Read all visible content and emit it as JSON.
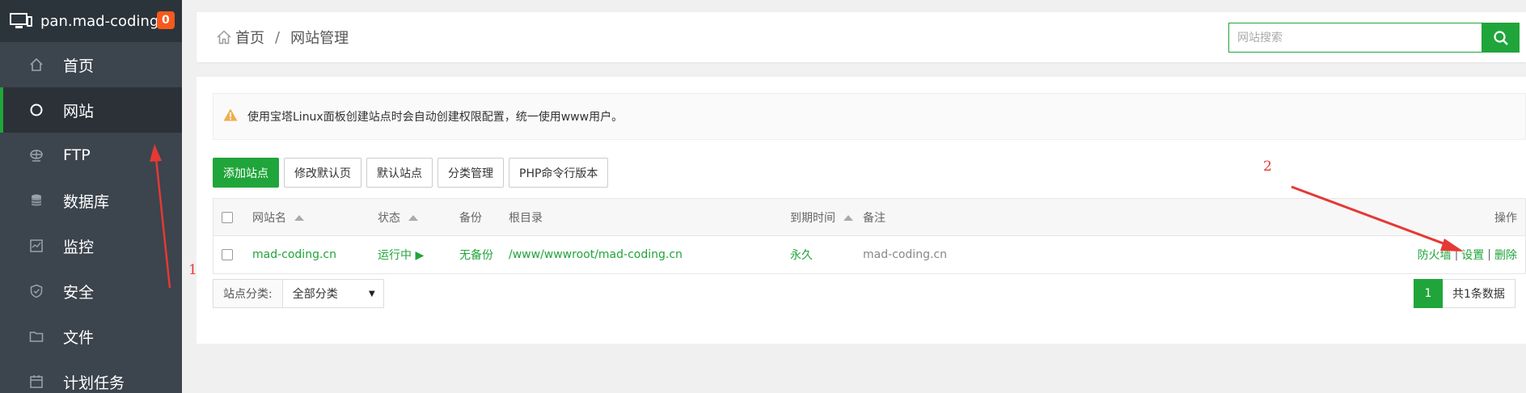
{
  "sidebar": {
    "host": "pan.mad-coding.",
    "badge": "0",
    "items": [
      {
        "label": "首页",
        "icon": "home-icon",
        "active": false
      },
      {
        "label": "网站",
        "icon": "globe-icon",
        "active": true
      },
      {
        "label": "FTP",
        "icon": "ftp-icon",
        "active": false
      },
      {
        "label": "数据库",
        "icon": "database-icon",
        "active": false
      },
      {
        "label": "监控",
        "icon": "monitor-icon",
        "active": false
      },
      {
        "label": "安全",
        "icon": "shield-icon",
        "active": false
      },
      {
        "label": "文件",
        "icon": "folder-icon",
        "active": false
      },
      {
        "label": "计划任务",
        "icon": "calendar-icon",
        "active": false
      }
    ]
  },
  "breadcrumb": {
    "home": "首页",
    "separator": "/",
    "current": "网站管理"
  },
  "search": {
    "placeholder": "网站搜索"
  },
  "notice": {
    "text": "使用宝塔Linux面板创建站点时会自动创建权限配置，统一使用www用户。"
  },
  "toolbar": {
    "add_site": "添加站点",
    "edit_default": "修改默认页",
    "default_site": "默认站点",
    "category": "分类管理",
    "php_cli": "PHP命令行版本"
  },
  "table": {
    "headers": {
      "name": "网站名",
      "status": "状态",
      "backup": "备份",
      "root": "根目录",
      "expire": "到期时间",
      "remark": "备注",
      "ops": "操作"
    },
    "rows": [
      {
        "name": "mad-coding.cn",
        "status": "运行中 ▶",
        "backup": "无备份",
        "root": "/www/wwwroot/mad-coding.cn",
        "expire": "永久",
        "remark": "mad-coding.cn",
        "op_firewall": "防火墙",
        "op_settings": "设置",
        "op_delete": "删除",
        "op_sep": "|"
      }
    ]
  },
  "footer": {
    "category_label": "站点分类:",
    "category_value": "全部分类",
    "page": "1",
    "total": "共1条数据"
  },
  "annotations": {
    "one": "1",
    "two": "2"
  },
  "colors": {
    "accent": "#20a53a",
    "sidebar": "#3c444d",
    "badge": "#f7591d",
    "annotation": "#e53935"
  }
}
